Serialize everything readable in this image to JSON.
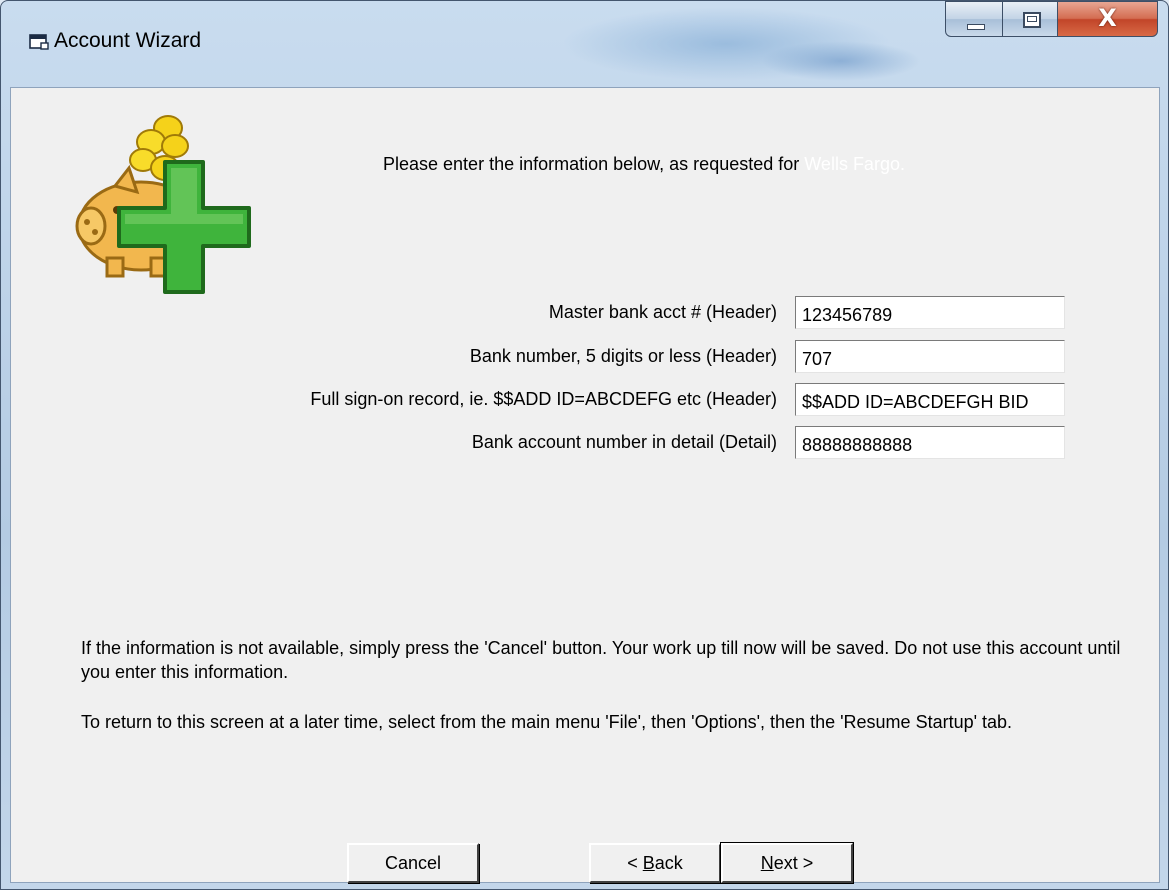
{
  "window": {
    "title": "Account Wizard",
    "controls": {
      "minimize": "minimize",
      "maximize": "maximize",
      "close": "X"
    },
    "app_icon": "window-icon"
  },
  "logo": {
    "icon": "piggy-bank-plus-icon",
    "colors": {
      "coins": "#f5d21a",
      "pig": "#f2b74e",
      "plus": "#3fb43c"
    }
  },
  "intro": {
    "text": "Please enter the information below, as requested for ",
    "bank_name": "Wells Fargo."
  },
  "fields": [
    {
      "label": "Master bank acct # (Header)",
      "value": "123456789"
    },
    {
      "label": "Bank number, 5 digits or less (Header)",
      "value": "707"
    },
    {
      "label": "Full sign-on record, ie. $$ADD ID=ABCDEFG etc (Header)",
      "value": "$$ADD ID=ABCDEFGH BID"
    },
    {
      "label": "Bank account number in detail (Detail)",
      "value": "88888888888"
    }
  ],
  "info": {
    "paragraph1": "If the information is not available, simply press the 'Cancel' button.  Your work up till now will be saved.  Do not use this account until you enter this information.",
    "paragraph2": "To return to this screen at a later time, select from the main menu 'File', then 'Options', then the 'Resume Startup' tab."
  },
  "buttons": {
    "cancel": "Cancel",
    "back_prefix": "< ",
    "back_key": "B",
    "back_rest": "ack",
    "next_key": "N",
    "next_rest": "ext >"
  }
}
